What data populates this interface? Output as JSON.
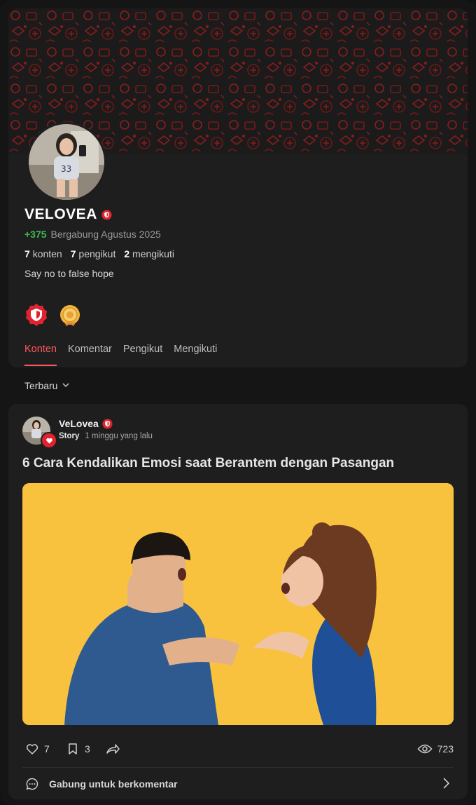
{
  "profile": {
    "display_name": "VELOVEA",
    "points": "+375",
    "joined": "Bergabung Agustus 2025",
    "stats": [
      {
        "count": "7",
        "label": "konten"
      },
      {
        "count": "7",
        "label": "pengikut"
      },
      {
        "count": "2",
        "label": "mengikuti"
      }
    ],
    "bio": "Say no to false hope",
    "badges": [
      "shield-badge-icon",
      "medal-badge-icon"
    ]
  },
  "tabs": [
    {
      "label": "Konten",
      "active": true
    },
    {
      "label": "Komentar",
      "active": false
    },
    {
      "label": "Pengikut",
      "active": false
    },
    {
      "label": "Mengikuti",
      "active": false
    }
  ],
  "sort": {
    "label": "Terbaru"
  },
  "post": {
    "author": "VeLovea",
    "category": "Story",
    "time": "1 minggu yang lalu",
    "title": "6 Cara Kendalikan Emosi saat Berantem dengan Pasangan",
    "likes": "7",
    "bookmarks": "3",
    "views": "723",
    "comment_prompt": "Gabung untuk berkomentar"
  },
  "colors": {
    "accent": "#ff5a5a",
    "points_green": "#3fb950",
    "card_bg": "#1e1e1e",
    "page_bg": "#151515",
    "image_bg": "#f8c23f"
  }
}
